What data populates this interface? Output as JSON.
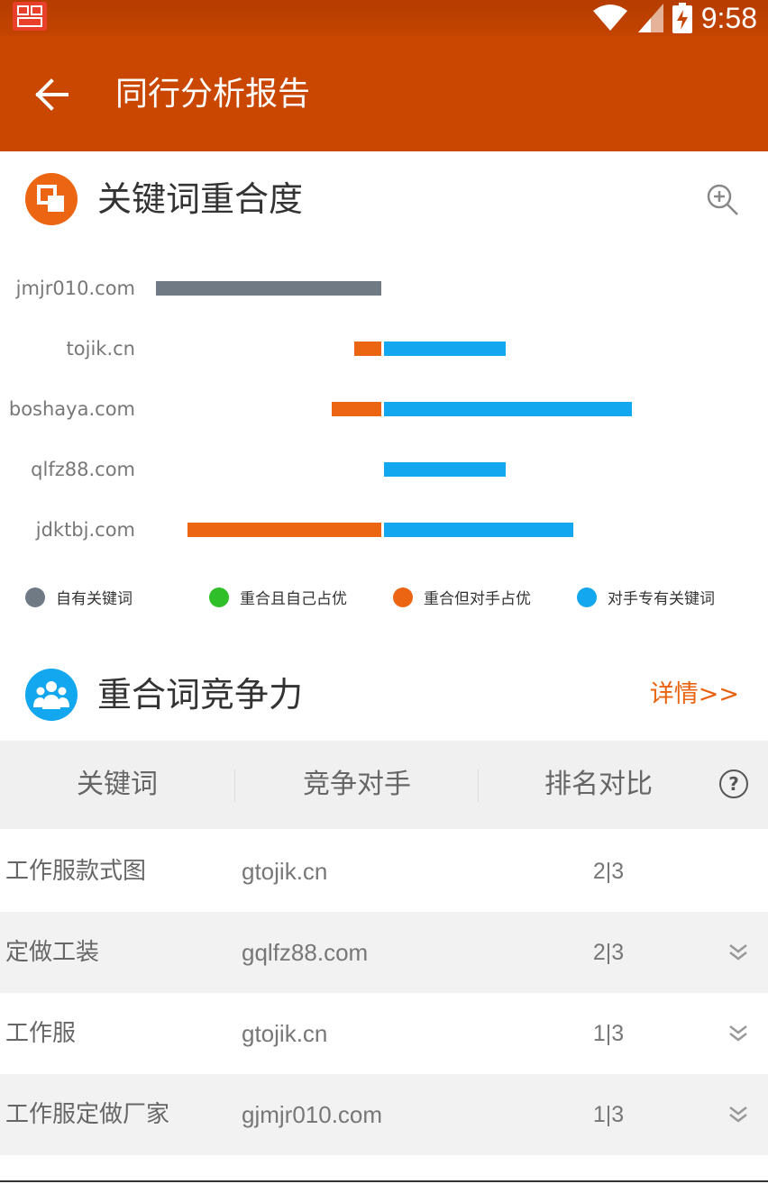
{
  "status": {
    "time": "9:58",
    "app_icon": "app-icon",
    "icons": [
      "wifi-icon",
      "signal-icon",
      "battery-charging-icon"
    ]
  },
  "header": {
    "title": "同行分析报告",
    "back_icon": "arrow-left-icon"
  },
  "overlap_section": {
    "title": "关键词重合度",
    "icon": "overlap-squares-icon",
    "zoom_icon": "zoom-in-icon"
  },
  "chart_data": {
    "type": "bar",
    "categories": [
      "jmjr010.com",
      "tojik.cn",
      "boshaya.com",
      "qlfz88.com",
      "jdktbj.com"
    ],
    "series": [
      {
        "name": "自有关键词",
        "color": "#707a85",
        "values": [
          -5,
          0,
          0,
          0,
          0
        ]
      },
      {
        "name": "重合且自己占优",
        "color": "#2fbf29",
        "values": [
          0,
          0,
          0,
          0,
          0
        ]
      },
      {
        "name": "重合但对手占优",
        "color": "#ec6512",
        "values": [
          0,
          -0.6,
          -1.1,
          0,
          -4.3
        ]
      },
      {
        "name": "对手专有关键词",
        "color": "#12a7ee",
        "values": [
          0,
          2.7,
          5.5,
          2.7,
          4.2
        ]
      }
    ],
    "xlim": [
      -5,
      5.5
    ],
    "diverging": true,
    "legend_position": "bottom"
  },
  "legend": [
    {
      "label": "自有关键词",
      "color": "#707a85"
    },
    {
      "label": "重合且自己占优",
      "color": "#2fbf29"
    },
    {
      "label": "重合但对手占优",
      "color": "#ec6512"
    },
    {
      "label": "对手专有关键词",
      "color": "#12a7ee"
    }
  ],
  "competition_section": {
    "title": "重合词竞争力",
    "icon": "people-group-icon",
    "detail_link": "详情>>"
  },
  "table": {
    "headers": [
      "关键词",
      "竞争对手",
      "排名对比"
    ],
    "help_icon": "?",
    "rows": [
      {
        "keyword": "工作服款式图",
        "competitor": "gtojik.cn",
        "rank": "2|3",
        "expandable": false
      },
      {
        "keyword": "定做工装",
        "competitor": "gqlfz88.com",
        "rank": "2|3",
        "expandable": true
      },
      {
        "keyword": "工作服",
        "competitor": "gtojik.cn",
        "rank": "1|3",
        "expandable": true
      },
      {
        "keyword": "工作服定做厂家",
        "competitor": "gjmjr010.com",
        "rank": "1|3",
        "expandable": true
      }
    ]
  },
  "colors": {
    "primary": "#c94700",
    "accent": "#e8620e",
    "blue": "#12a7ee"
  }
}
